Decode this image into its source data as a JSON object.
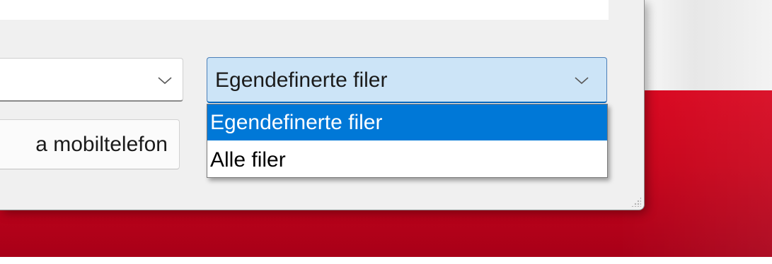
{
  "dialog": {
    "file_type_combo": {
      "selected_value": "Egendefinerte filer",
      "expanded": true,
      "options": [
        {
          "label": "Egendefinerte filer",
          "highlighted": true
        },
        {
          "label": "Alle filer",
          "highlighted": false
        }
      ]
    },
    "left_combo": {
      "value": ""
    },
    "left_button": {
      "label": "a mobiltelefon"
    }
  },
  "icons": {
    "combo_arrow": "chevron-down-icon",
    "resize_grip": "resize-grip-icon"
  },
  "colors": {
    "accent": "#0078d7",
    "combo_focus_bg": "#cce4f7",
    "dialog_bg": "#f0f0f0",
    "wallpaper_red": "#d8061f"
  }
}
